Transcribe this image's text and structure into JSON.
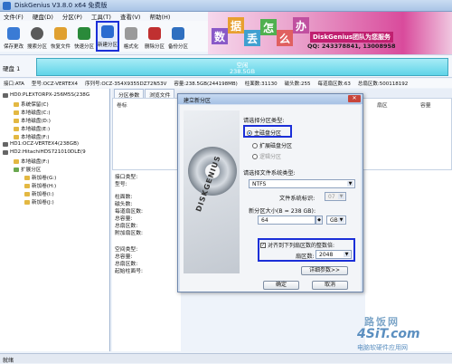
{
  "window": {
    "title": "DiskGenius V3.8.0 x64 免费版"
  },
  "menu": [
    "文件(F)",
    "硬盘(D)",
    "分区(P)",
    "工具(T)",
    "查看(V)",
    "帮助(H)"
  ],
  "toolbar": [
    {
      "label": "保存更改",
      "color": "#3a7bd5"
    },
    {
      "label": "搜索分区",
      "color": "#5a5a5a"
    },
    {
      "label": "恢复文件",
      "color": "#e0a030"
    },
    {
      "label": "快速分区",
      "color": "#2a8a3a"
    },
    {
      "label": "新建分区",
      "color": "#2a6bd0"
    },
    {
      "label": "格式化",
      "color": "#888"
    },
    {
      "label": "删除分区",
      "color": "#c03030"
    },
    {
      "label": "备份分区",
      "color": "#3070c0"
    }
  ],
  "banner": {
    "chars": [
      "数",
      "据",
      "丢",
      "怎",
      "么",
      "办"
    ],
    "brand": "DiskGenius团队为您服务",
    "contact": "QQ: 243378841, 13008958"
  },
  "disk": {
    "label": "硬盘 1",
    "bar_line1": "空闲",
    "bar_line2": "238.5GB"
  },
  "info": {
    "interface": "接口:ATA",
    "model": "型号:OCZ-VERTEX4",
    "serial": "序列号:OCZ-354X9355DZ72N53V",
    "capacity": "容量:238.5GB(244198MB)",
    "cylinders": "柱面数:31130",
    "heads": "磁头数:255",
    "sectors": "每道扇区数:63",
    "total": "总扇区数:500118192"
  },
  "tree": [
    {
      "text": "HD0:PLEXTORPX-256M5S(238G",
      "kind": "disk",
      "indent": 0
    },
    {
      "text": "系统保留(C)",
      "kind": "part",
      "indent": 2
    },
    {
      "text": "本地磁盘(C:)",
      "kind": "part",
      "indent": 2
    },
    {
      "text": "本地磁盘(D:)",
      "kind": "part",
      "indent": 2
    },
    {
      "text": "本地磁盘(E:)",
      "kind": "part",
      "indent": 2
    },
    {
      "text": "本地磁盘(F:)",
      "kind": "part",
      "indent": 2
    },
    {
      "text": "HD1:OCZ-VERTEX4(238GB)",
      "kind": "disk",
      "indent": 0
    },
    {
      "text": "HD2:HitachiHDS721010DLE(9",
      "kind": "disk",
      "indent": 0
    },
    {
      "text": "本地磁盘(F:)",
      "kind": "part",
      "indent": 2
    },
    {
      "text": "扩展分区",
      "kind": "part",
      "indent": 2
    },
    {
      "text": "新加卷(G:)",
      "kind": "part",
      "indent": 4
    },
    {
      "text": "新加卷(H:)",
      "kind": "part",
      "indent": 4
    },
    {
      "text": "新加卷(I:)",
      "kind": "part",
      "indent": 4
    },
    {
      "text": "新加卷(J:)",
      "kind": "part",
      "indent": 4
    }
  ],
  "tabs": [
    "分区参数",
    "浏览文件"
  ],
  "grid_headers": [
    "卷标",
    "扇区",
    "容量"
  ],
  "details": [
    "接口类型:",
    "型号:",
    "柱面数:",
    "磁头数:",
    "每道扇区数:",
    "总容量:",
    "总扇区数:",
    "附加扇区数:",
    "空间类型:",
    "总容量:",
    "总扇区数:",
    "起始柱面号:"
  ],
  "dialog": {
    "title": "建立新分区",
    "close": "✕",
    "hdd_label": "DISKGENIUS",
    "type_label": "请选择分区类型:",
    "types": [
      {
        "label": "主磁盘分区",
        "selected": true,
        "disabled": false
      },
      {
        "label": "扩展磁盘分区",
        "selected": false,
        "disabled": false
      },
      {
        "label": "逻辑分区",
        "selected": false,
        "disabled": true
      }
    ],
    "fs_label": "请选择文件系统类型:",
    "fs_value": "NTFS",
    "fs_id_label": "文件系统标识:",
    "fs_id_value": "07",
    "size_label": "新分区大小(B = 238 GB):",
    "size_value": "64",
    "size_unit": "GB",
    "align_label": "对齐到下列扇区数的整数倍:",
    "align_sectors_label": "扇区数:",
    "align_sectors_value": "2048",
    "advanced_button": "详细参数>>",
    "ok_button": "确定",
    "cancel_button": "取消"
  },
  "watermark": {
    "line1": "路饭网",
    "line2": "4SiT.com",
    "line3": "电脑软硬件应用网"
  },
  "status": "就绪"
}
